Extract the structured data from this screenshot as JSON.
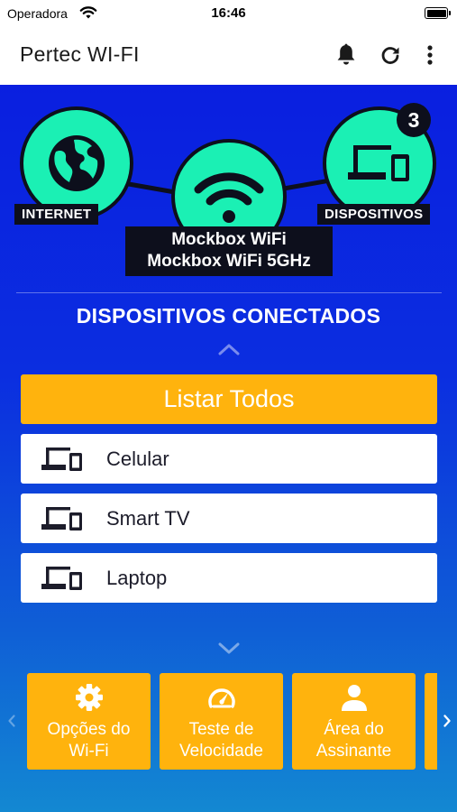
{
  "status_bar": {
    "carrier": "Operadora",
    "time": "16:46"
  },
  "app_bar": {
    "title": "Pertec WI-FI",
    "actions": [
      "bell-icon",
      "refresh-icon",
      "more-vert-icon"
    ]
  },
  "network": {
    "internet_label": "INTERNET",
    "devices_label": "DISPOSITIVOS",
    "devices_count": "3",
    "wifi_names": [
      "Mockbox WiFi",
      "Mockbox WiFi 5GHz"
    ]
  },
  "connected": {
    "title": "DISPOSITIVOS CONECTADOS",
    "list_all_label": "Listar Todos",
    "devices": [
      {
        "label": "Celular",
        "icon": "devices-icon"
      },
      {
        "label": "Smart TV",
        "icon": "devices-icon"
      },
      {
        "label": "Laptop",
        "icon": "devices-icon"
      }
    ]
  },
  "shortcuts": [
    {
      "label": "Opções do Wi-Fi",
      "lines": [
        "Opções do",
        "Wi-Fi"
      ],
      "icon": "gear-icon"
    },
    {
      "label": "Teste de Velocidade",
      "lines": [
        "Teste de",
        "Velocidade"
      ],
      "icon": "speedometer-icon"
    },
    {
      "label": "Área do Assinante",
      "lines": [
        "Área do",
        "Assinante"
      ],
      "icon": "person-icon"
    }
  ],
  "colors": {
    "accent": "#ffb30d",
    "node": "#1bf0b4",
    "dark": "#0d0f1c",
    "gradient_top": "#0a1fe0",
    "gradient_bottom": "#1388d2"
  }
}
